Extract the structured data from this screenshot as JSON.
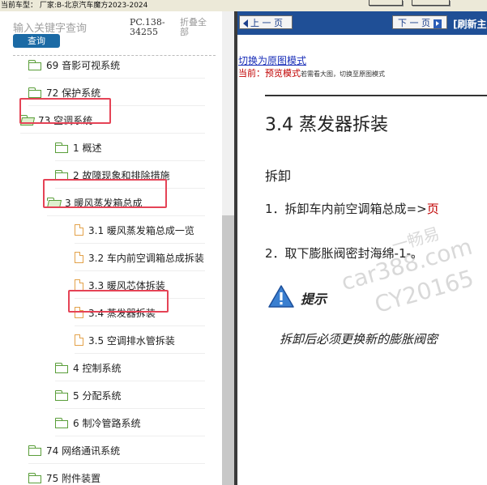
{
  "topbar": {
    "label": "当前车型：  厂家:B-北京汽车魔方2023-2024"
  },
  "sidebar": {
    "search_placeholder": "输入关键字查询",
    "search_button": "查询",
    "pc_code": "PC.138-34255",
    "collapse_all": "折叠全部",
    "items": [
      {
        "label": "69 音影可视系统",
        "type": "folder",
        "open": false
      },
      {
        "label": "72 保护系统",
        "type": "folder",
        "open": false
      },
      {
        "label": "73 空调系统",
        "type": "folder",
        "open": true,
        "highlighted": true
      },
      {
        "label": "1 概述",
        "type": "folder",
        "open": false
      },
      {
        "label": "2 故障现象和排除措施",
        "type": "folder",
        "open": false
      },
      {
        "label": "3 暖风蒸发箱总成",
        "type": "folder",
        "open": true,
        "highlighted": true
      },
      {
        "label": "3.1 暖风蒸发箱总成一览",
        "type": "doc"
      },
      {
        "label": "3.2 车内前空调箱总成拆装",
        "type": "doc"
      },
      {
        "label": "3.3 暖风芯体拆装",
        "type": "doc"
      },
      {
        "label": "3.4 蒸发器拆装",
        "type": "doc",
        "highlighted": true
      },
      {
        "label": "3.5 空调排水管拆装",
        "type": "doc"
      },
      {
        "label": "4 控制系统",
        "type": "folder",
        "open": false
      },
      {
        "label": "5 分配系统",
        "type": "folder",
        "open": false
      },
      {
        "label": "6 制冷管路系统",
        "type": "folder",
        "open": false
      },
      {
        "label": "74 网络通讯系统",
        "type": "folder",
        "open": false
      },
      {
        "label": "75 附件装置",
        "type": "folder",
        "open": false
      }
    ]
  },
  "content": {
    "prev_page": "上 一 页",
    "next_page": "下 一 页",
    "refresh": "[刷新主",
    "switch_link": "切换为原图模式",
    "mode_prefix": "当前：",
    "mode_name": "预览模式",
    "mode_hint": "若需看大图，切换至原图模式",
    "doc_title": "3.4 蒸发器拆装",
    "section": "拆卸",
    "step1_text": "1．拆卸车内前空调箱总成=>",
    "step1_link": "页",
    "step2_text": "2．取下膨胀阀密封海绵-1-。",
    "tip_label": "提示",
    "tip_text": "拆卸后必须更换新的膨胀阀密"
  },
  "watermark": {
    "line1": "一畅易",
    "line2": "car388.com",
    "line3": "CY20165"
  },
  "colors": {
    "highlight": "#e54356",
    "nav_bar": "#1f4f96",
    "search_button": "#1b6aa5",
    "link": "#1a2fb8",
    "mode_red": "#c00000"
  }
}
